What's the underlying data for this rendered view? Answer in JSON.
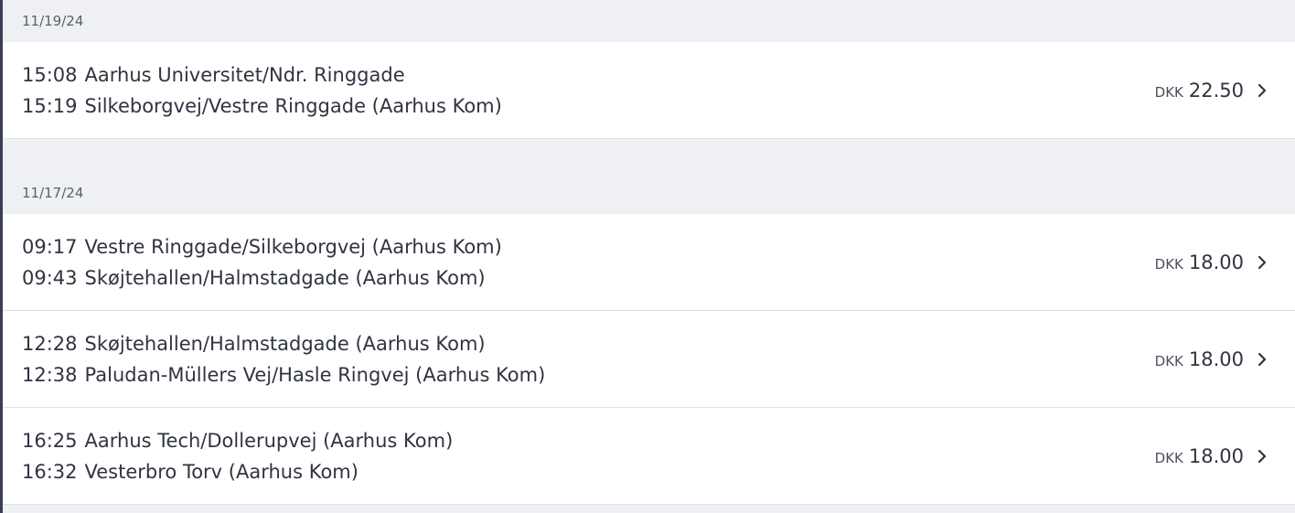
{
  "groups": [
    {
      "date": "11/19/24",
      "trips": [
        {
          "from_time": "15:08",
          "from_stop": "Aarhus Universitet/Ndr. Ringgade",
          "to_time": "15:19",
          "to_stop": "Silkeborgvej/Vestre Ringgade (Aarhus Kom)",
          "currency": "DKK",
          "amount": "22.50"
        }
      ]
    },
    {
      "date": "11/17/24",
      "trips": [
        {
          "from_time": "09:17",
          "from_stop": "Vestre Ringgade/Silkeborgvej (Aarhus Kom)",
          "to_time": "09:43",
          "to_stop": "Skøjtehallen/Halmstadgade (Aarhus Kom)",
          "currency": "DKK",
          "amount": "18.00"
        },
        {
          "from_time": "12:28",
          "from_stop": "Skøjtehallen/Halmstadgade (Aarhus Kom)",
          "to_time": "12:38",
          "to_stop": "Paludan-Müllers Vej/Hasle Ringvej (Aarhus Kom)",
          "currency": "DKK",
          "amount": "18.00"
        },
        {
          "from_time": "16:25",
          "from_stop": "Aarhus Tech/Dollerupvej (Aarhus Kom)",
          "to_time": "16:32",
          "to_stop": "Vesterbro Torv (Aarhus Kom)",
          "currency": "DKK",
          "amount": "18.00"
        }
      ]
    }
  ],
  "icons": {
    "chevron": "chevron-right-icon"
  },
  "colors": {
    "background": "#eef0f4",
    "row": "#ffffff",
    "text": "#2f3440",
    "muted": "#5a606c",
    "edge": "#3a3f4f"
  }
}
